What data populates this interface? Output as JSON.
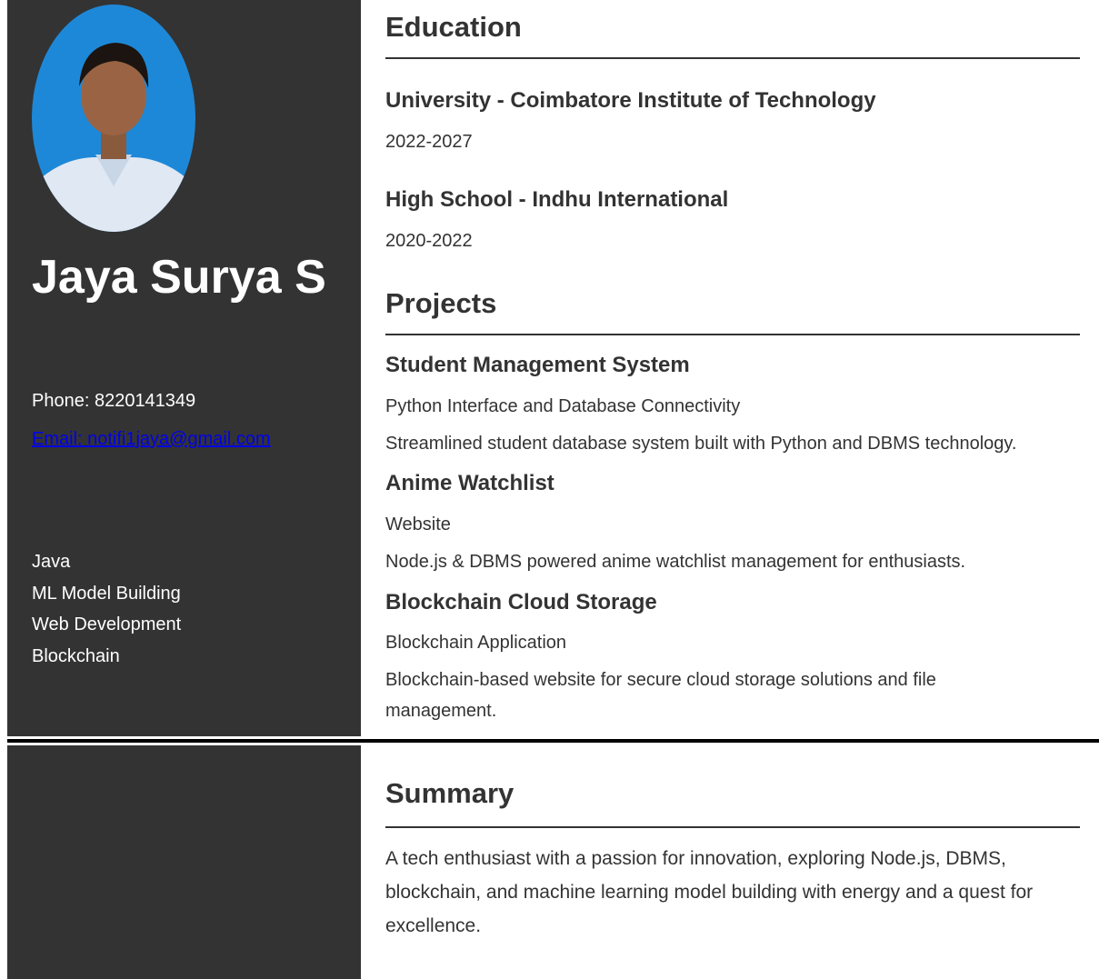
{
  "profile": {
    "name": "Jaya Surya S",
    "phone": "Phone: 8220141349",
    "email": "Email: notifi1jaya@gmail.com"
  },
  "skills": [
    "Java",
    "ML Model Building",
    "Web Development",
    "Blockchain"
  ],
  "education": {
    "heading": "Education",
    "entries": [
      {
        "title": "University - Coimbatore Institute of Technology",
        "years": "2022-2027"
      },
      {
        "title": "High School - Indhu International",
        "years": "2020-2022"
      }
    ]
  },
  "projects": {
    "heading": "Projects",
    "entries": [
      {
        "title": "Student Management System",
        "subtitle": "Python Interface and Database Connectivity",
        "description": "Streamlined student database system built with Python and DBMS technology."
      },
      {
        "title": "Anime Watchlist",
        "subtitle": "Website",
        "description": "Node.js & DBMS powered anime watchlist management for enthusiasts."
      },
      {
        "title": "Blockchain Cloud Storage",
        "subtitle": "Blockchain Application",
        "description": "Blockchain-based website for secure cloud storage solutions and file management."
      }
    ]
  },
  "summary": {
    "heading": "Summary",
    "text": "A tech enthusiast with a passion for innovation, exploring Node.js, DBMS, blockchain, and machine learning model building with energy and a quest for excellence."
  },
  "colors": {
    "sidebar": "#333333",
    "text": "#333333",
    "link": "#0000ee",
    "photo_background": "#1e88d8"
  }
}
